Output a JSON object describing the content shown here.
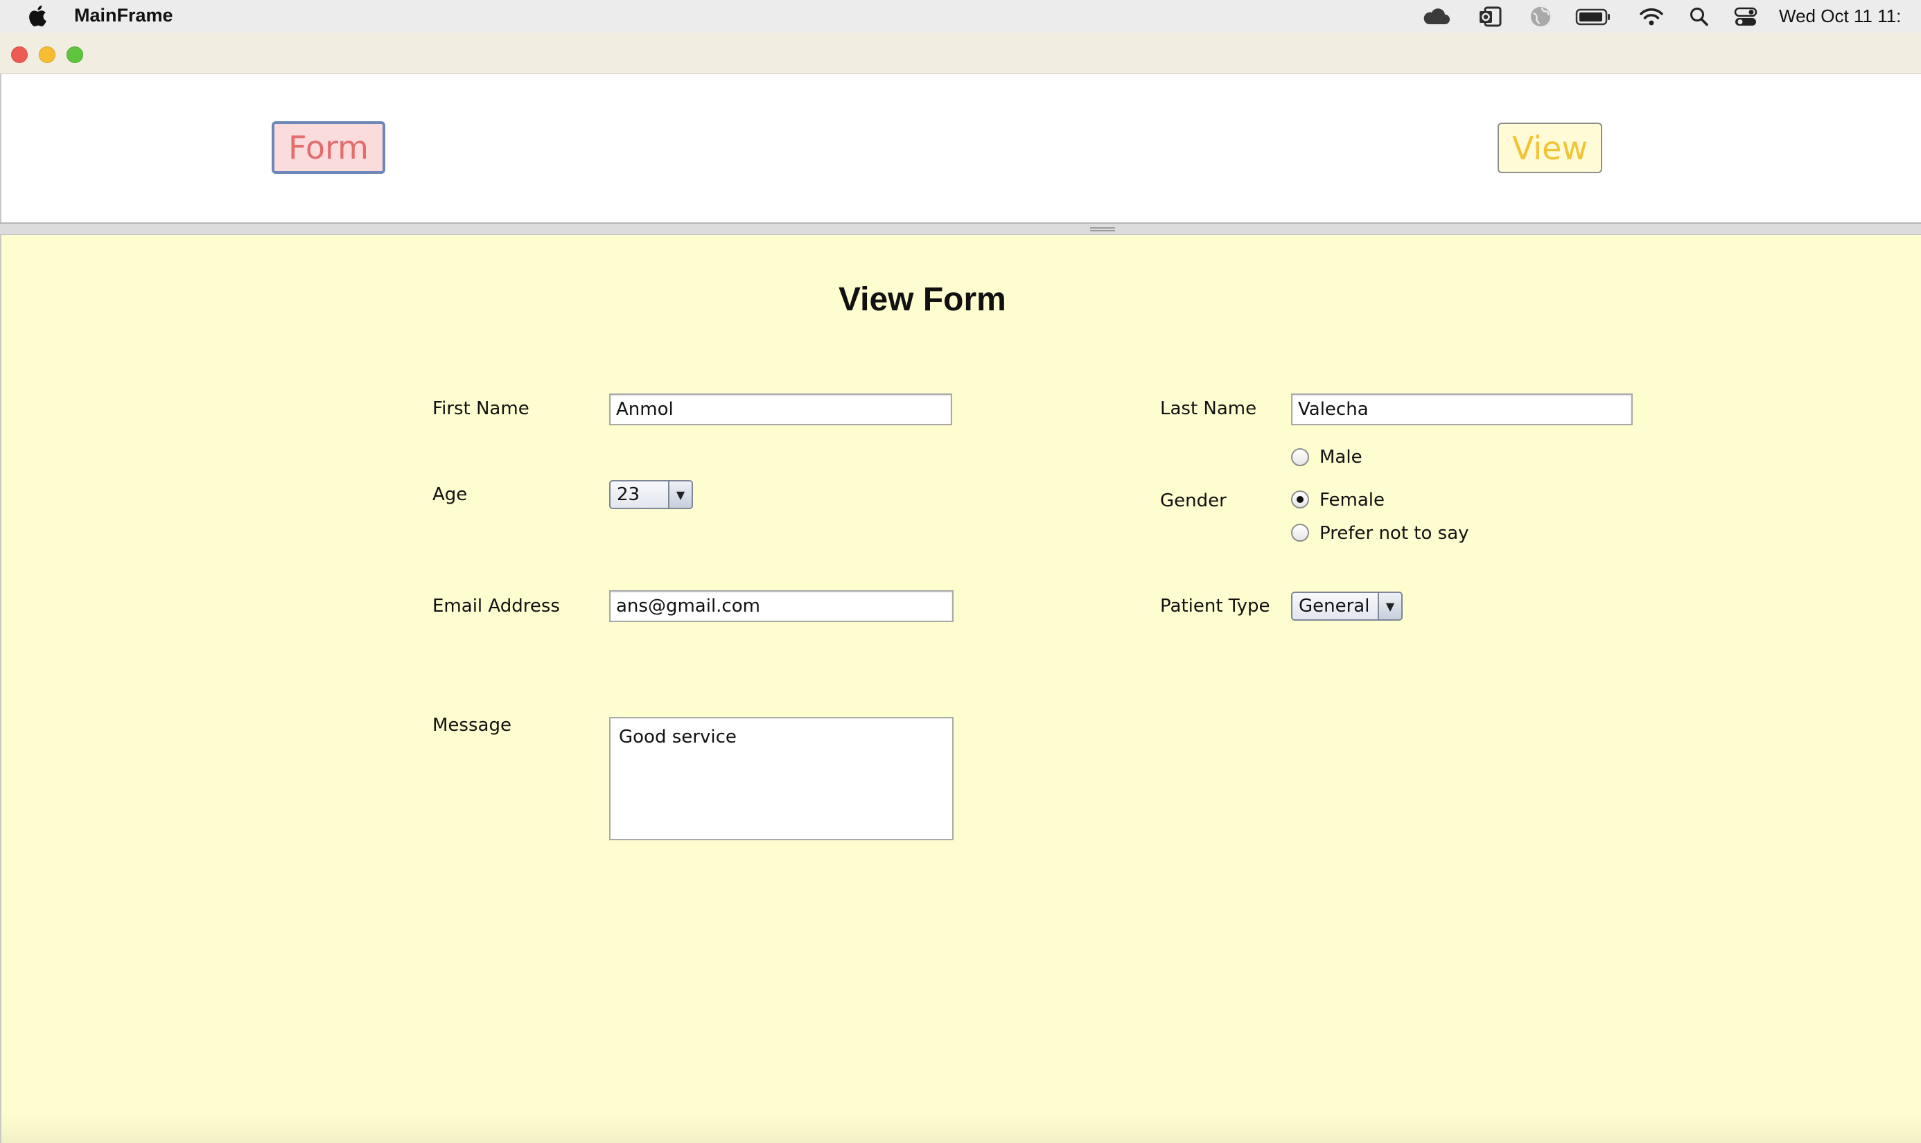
{
  "menubar": {
    "app_name": "MainFrame",
    "clock": "Wed Oct 11  11:",
    "icons": [
      "apple-icon",
      "cloud-icon",
      "outlook-icon",
      "globe-icon",
      "battery-icon",
      "wifi-icon",
      "search-icon",
      "control-center-icon"
    ]
  },
  "window": {
    "controls": [
      "close",
      "minimize",
      "maximize"
    ]
  },
  "nav": {
    "form_label": "Form",
    "view_label": "View",
    "form_colors": {
      "background": "#fbdcdc",
      "text": "#e36c6c",
      "border": "#6d87b8"
    },
    "view_colors": {
      "background": "#fffbd6",
      "text": "#f1c335"
    }
  },
  "form": {
    "background": "#fefdd0",
    "title": "View Form",
    "first_name": {
      "label": "First Name",
      "value": "Anmol"
    },
    "last_name": {
      "label": "Last Name",
      "value": "Valecha"
    },
    "age": {
      "label": "Age",
      "value": "23"
    },
    "gender": {
      "label": "Gender",
      "options": [
        "Male",
        "Female",
        "Prefer not to say"
      ],
      "selected": "Female"
    },
    "email": {
      "label": "Email Address",
      "value": "ans@gmail.com"
    },
    "patient_type": {
      "label": "Patient Type",
      "value": "General"
    },
    "message": {
      "label": "Message",
      "value": "Good service"
    }
  }
}
